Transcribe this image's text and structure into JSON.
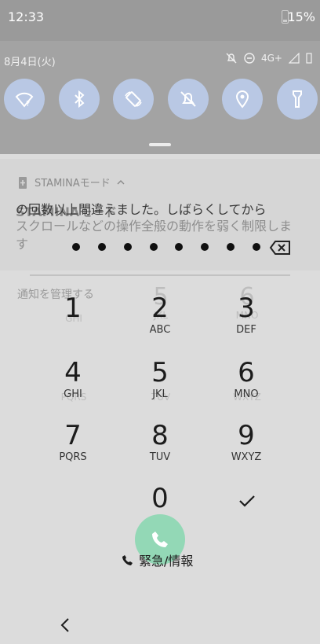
{
  "status_bar": {
    "time": "12:33",
    "battery": "15%"
  },
  "quick_settings": {
    "date": "8月4日(火)",
    "network": "4G+",
    "tiles": [
      {
        "icon": "wifi-question-icon"
      },
      {
        "icon": "bluetooth-icon"
      },
      {
        "icon": "auto-rotate-icon"
      },
      {
        "icon": "do-not-disturb-off-icon"
      },
      {
        "icon": "location-icon"
      },
      {
        "icon": "flashlight-icon"
      }
    ]
  },
  "notification": {
    "app": "STAMINAモード",
    "title": "STAMINAモード",
    "body": "スクロールなどの操作全般の動作を弱く制限しま す",
    "manage": "通知を管理する"
  },
  "lock": {
    "message": "の回数以上間違えました。しばらくしてから",
    "dot_count": 8
  },
  "keypad": {
    "keys": [
      {
        "digit": "1",
        "letters": ""
      },
      {
        "digit": "2",
        "letters": "ABC"
      },
      {
        "digit": "3",
        "letters": "DEF"
      },
      {
        "digit": "4",
        "letters": "GHI"
      },
      {
        "digit": "5",
        "letters": "JKL"
      },
      {
        "digit": "6",
        "letters": "MNO"
      },
      {
        "digit": "7",
        "letters": "PQRS"
      },
      {
        "digit": "8",
        "letters": "TUV"
      },
      {
        "digit": "9",
        "letters": "WXYZ"
      },
      {
        "digit": "0",
        "letters": "+"
      }
    ],
    "ghost_keys": [
      {
        "digit": "",
        "letters": "GHI"
      },
      {
        "digit": "5",
        "letters": "JKL"
      },
      {
        "digit": "6",
        "letters": "MNO"
      },
      {
        "digit": "",
        "letters": "PQRS"
      },
      {
        "digit": "",
        "letters": "TUV"
      },
      {
        "digit": "",
        "letters": "WXYZ"
      }
    ]
  },
  "emergency": {
    "label": "緊急/情報"
  },
  "colors": {
    "accent_green": "#93d8b6",
    "tile_blue": "#b9c8e4"
  }
}
